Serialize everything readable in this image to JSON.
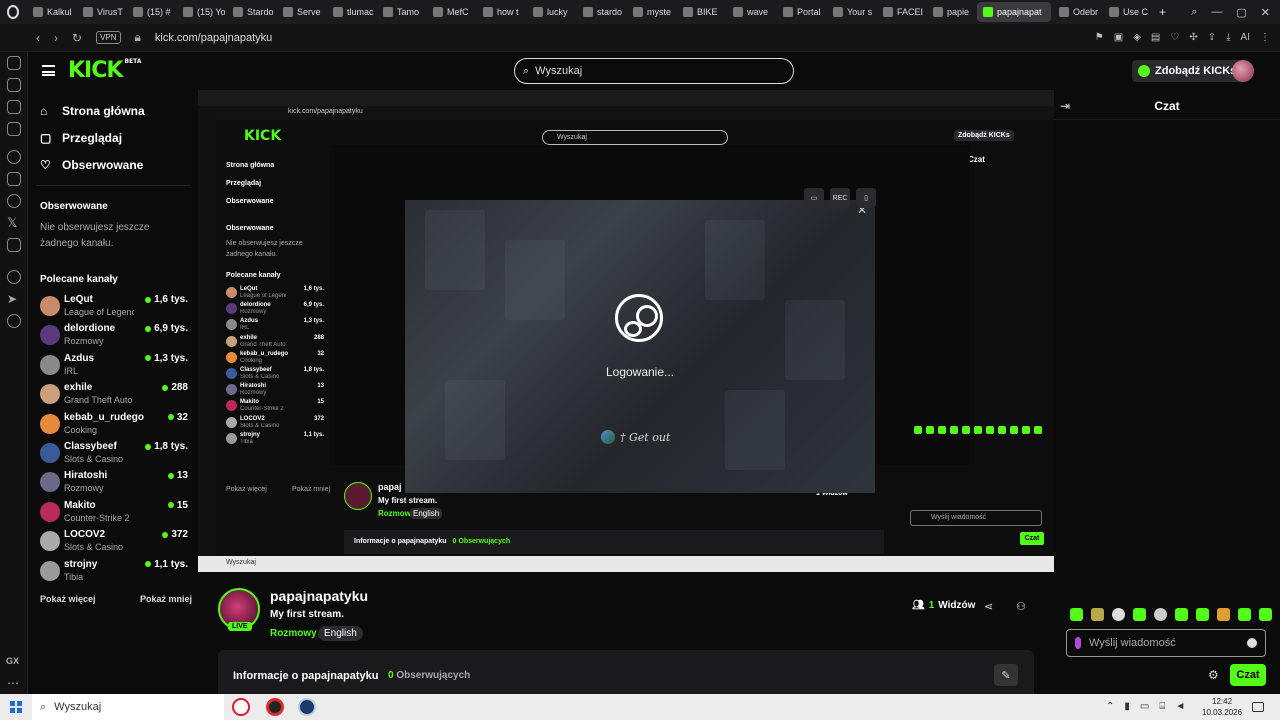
{
  "browser": {
    "tabs": [
      {
        "label": "Kalkul"
      },
      {
        "label": "VirusT"
      },
      {
        "label": "(15) #"
      },
      {
        "label": "(15) Yo"
      },
      {
        "label": "Stardo"
      },
      {
        "label": "Serve"
      },
      {
        "label": "tlumac"
      },
      {
        "label": "Tamo"
      },
      {
        "label": "MefC"
      },
      {
        "label": "how t"
      },
      {
        "label": "lucky"
      },
      {
        "label": "stardo"
      },
      {
        "label": "myste"
      },
      {
        "label": "BIKE"
      },
      {
        "label": "wave"
      },
      {
        "label": "Portal"
      },
      {
        "label": "Your s"
      },
      {
        "label": "FACEI"
      },
      {
        "label": "papie"
      },
      {
        "label": "papajnapat"
      },
      {
        "label": "Odebr"
      },
      {
        "label": "Use C"
      }
    ],
    "active_tab_index": 19,
    "vpn_label": "VPN",
    "url": "kick.com/papajnapatyku"
  },
  "header": {
    "logo": "KICK",
    "logo_sup": "BETA",
    "search_placeholder": "Wyszukaj",
    "kicks_button": "Zdobądź KICKs"
  },
  "leftnav": {
    "items": [
      {
        "label": "Strona główna",
        "icon": "home-icon"
      },
      {
        "label": "Przeglądaj",
        "icon": "browse-icon"
      },
      {
        "label": "Obserwowane",
        "icon": "heart-icon"
      }
    ],
    "followed_title": "Obserwowane",
    "followed_empty": "Nie obserwujesz jeszcze żadnego kanału.",
    "recommended_title": "Polecane kanały",
    "channels": [
      {
        "name": "LeQut",
        "category": "League of Legends",
        "viewers": "1,6 tys.",
        "color": "#c98c6a"
      },
      {
        "name": "delordione",
        "category": "Rozmowy",
        "viewers": "6,9 tys.",
        "color": "#5a3a7a"
      },
      {
        "name": "Azdus",
        "category": "IRL",
        "viewers": "1,3 tys.",
        "color": "#8a8a8a"
      },
      {
        "name": "exhile",
        "category": "Grand Theft Auto V (G...",
        "viewers": "288",
        "color": "#c9a07a"
      },
      {
        "name": "kebab_u_rudego",
        "category": "Cooking",
        "viewers": "32",
        "color": "#e88a3a"
      },
      {
        "name": "Classybeef",
        "category": "Slots & Casino",
        "viewers": "1,8 tys.",
        "color": "#3a5a9a"
      },
      {
        "name": "Hiratoshi",
        "category": "Rozmowy",
        "viewers": "13",
        "color": "#6a6a8a"
      },
      {
        "name": "Makito",
        "category": "Counter-Strike 2",
        "viewers": "15",
        "color": "#b82a5a"
      },
      {
        "name": "LOCOV2",
        "category": "Slots & Casino",
        "viewers": "372",
        "color": "#aaaaaa"
      },
      {
        "name": "strojny",
        "category": "Tibia",
        "viewers": "1,1 tys.",
        "color": "#9a9a9a"
      }
    ],
    "show_more": "Pokaż więcej",
    "show_less": "Pokaż mniej"
  },
  "video": {
    "nested": {
      "logo": "KICK",
      "search_placeholder": "Wyszukaj",
      "kicks_button": "Zdobądź KICKs",
      "chat_title": "Czat",
      "url": "kick.com/papajnapatyku",
      "nav": [
        "Strona główna",
        "Przeglądaj",
        "Obserwowane"
      ],
      "followed_title": "Obserwowane",
      "followed_empty": "Nie obserwujesz jeszcze żadnego kanału.",
      "recommended_title": "Polecane kanały",
      "show_more": "Pokaż więcej",
      "show_less": "Pokaż mniej",
      "streamer": "papaj",
      "stream_title": "My first stream.",
      "category": "Rozmowy",
      "language": "English",
      "info": "Informacje o papajnapatyku",
      "followers": "0 Obserwujących",
      "viewers": "1 Widzów",
      "chat_placeholder": "Wyślij wiadomość",
      "chat_button": "Czat",
      "taskbar_search": "Wyszukaj"
    },
    "steam": {
      "status": "Logowanie...",
      "get_out": "† Get out"
    },
    "capture_label": "REC"
  },
  "chat": {
    "title": "Czat",
    "placeholder": "Wyślij wiadomość",
    "send_button": "Czat"
  },
  "stream": {
    "streamer": "papajnapatyku",
    "title": "My first stream.",
    "category": "Rozmowy",
    "language": "English",
    "live_badge": "LIVE",
    "viewers_count": "1",
    "viewers_label": "Widzów",
    "info_title": "Informacje o papajnapatyku",
    "followers_count": "0",
    "followers_label": "Obserwujących"
  },
  "taskbar": {
    "search_placeholder": "Wyszukaj",
    "time": "12:42",
    "date": "10.03.2026"
  },
  "colors": {
    "accent": "#53fc18",
    "background": "#0b0b0c"
  }
}
